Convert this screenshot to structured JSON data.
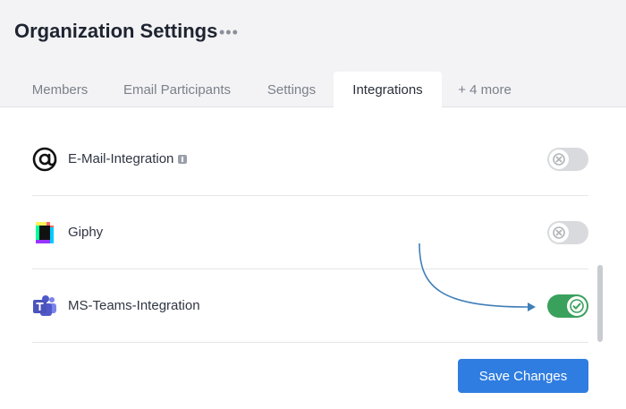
{
  "header": {
    "title": "Organization Settings",
    "more_glyph": "•••"
  },
  "tabs": [
    {
      "label": "Members",
      "active": false
    },
    {
      "label": "Email Participants",
      "active": false
    },
    {
      "label": "Settings",
      "active": false
    },
    {
      "label": "Integrations",
      "active": true
    },
    {
      "label": "+ 4 more",
      "active": false
    }
  ],
  "integrations": [
    {
      "label": "E-Mail-Integration",
      "icon": "at-sign-icon",
      "has_info": true,
      "enabled": false
    },
    {
      "label": "Giphy",
      "icon": "giphy-icon",
      "has_info": false,
      "enabled": false
    },
    {
      "label": "MS-Teams-Integration",
      "icon": "ms-teams-icon",
      "has_info": false,
      "enabled": true
    }
  ],
  "footer": {
    "save_label": "Save Changes"
  },
  "colors": {
    "accent": "#2f7de1",
    "toggle_on": "#3aa15c",
    "toggle_off": "#d9dadd",
    "annotation_arrow": "#3f7fb8"
  }
}
